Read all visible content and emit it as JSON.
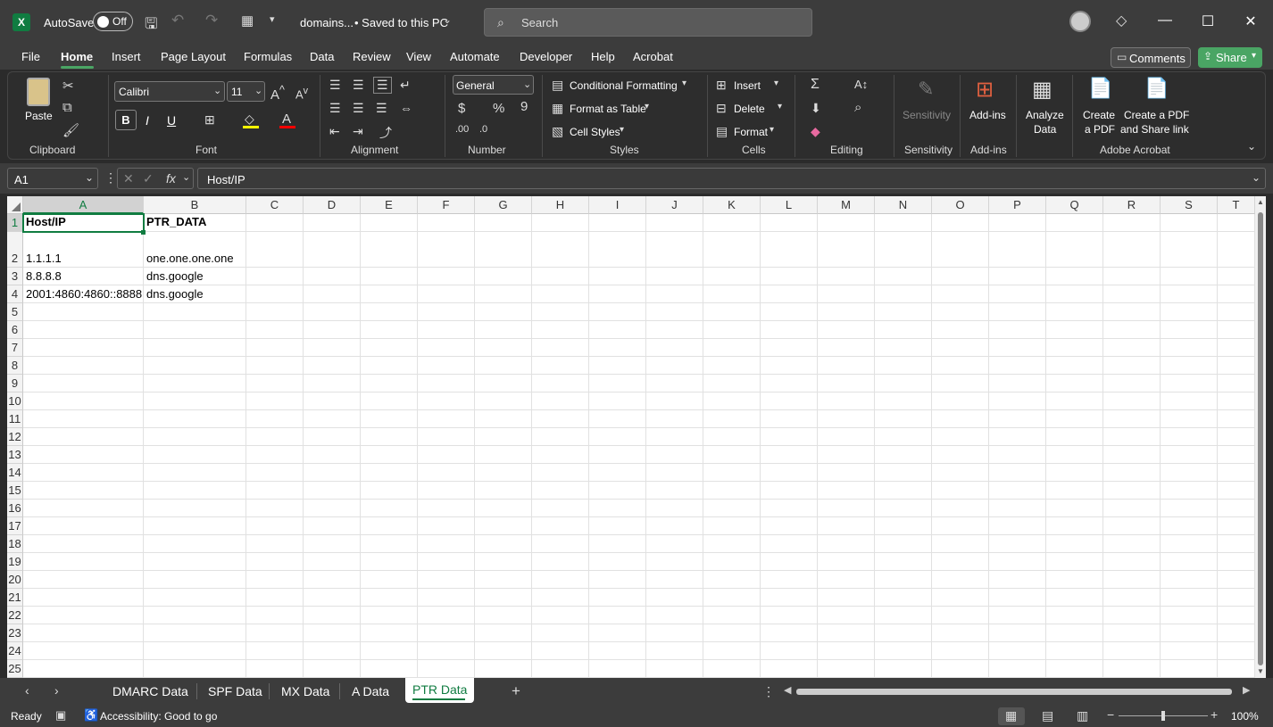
{
  "titlebar": {
    "autosave": "AutoSave",
    "autosave_state": "Off",
    "filename": "domains...",
    "save_status": "• Saved to this PC",
    "search_placeholder": "Search"
  },
  "menu": [
    "File",
    "Home",
    "Insert",
    "Page Layout",
    "Formulas",
    "Data",
    "Review",
    "View",
    "Automate",
    "Developer",
    "Help",
    "Acrobat"
  ],
  "menu_right": {
    "comments": "Comments",
    "share": "Share"
  },
  "ribbon": {
    "clipboard": {
      "paste": "Paste",
      "label": "Clipboard"
    },
    "font": {
      "name": "Calibri",
      "size": "11",
      "label": "Font",
      "bold": "B",
      "italic": "I",
      "underline": "U"
    },
    "alignment": {
      "label": "Alignment"
    },
    "number": {
      "format": "General",
      "label": "Number"
    },
    "styles": {
      "conditional": "Conditional Formatting",
      "table": "Format as Table",
      "cell_styles": "Cell Styles",
      "label": "Styles"
    },
    "cells": {
      "insert": "Insert",
      "delete": "Delete",
      "format": "Format",
      "label": "Cells"
    },
    "editing": {
      "label": "Editing"
    },
    "sensitivity": {
      "btn": "Sensitivity",
      "label": "Sensitivity"
    },
    "addins": {
      "btn": "Add-ins",
      "label": "Add-ins"
    },
    "analyze": {
      "line1": "Analyze",
      "line2": "Data"
    },
    "acrobat": {
      "create1": "Create",
      "create2": "a PDF",
      "share1": "Create a PDF",
      "share2": "and Share link",
      "label": "Adobe Acrobat"
    }
  },
  "formula_bar": {
    "name_box": "A1",
    "fx": "fx",
    "content": "Host/IP"
  },
  "columns": [
    "A",
    "B",
    "C",
    "D",
    "E",
    "F",
    "G",
    "H",
    "I",
    "J",
    "K",
    "L",
    "M",
    "N",
    "O",
    "P",
    "Q",
    "R",
    "S",
    "T"
  ],
  "rows": [
    "1",
    "2",
    "3",
    "4",
    "5",
    "6",
    "7",
    "8",
    "9",
    "10",
    "11",
    "12",
    "13",
    "14",
    "15",
    "16",
    "17",
    "18",
    "19",
    "20",
    "21",
    "22",
    "23",
    "24",
    "25"
  ],
  "cells": {
    "A1": "Host/IP",
    "B1": "PTR_DATA",
    "A2": "1.1.1.1",
    "B2": "one.one.one.one",
    "A3": "8.8.8.8",
    "B3": "dns.google",
    "A4": "2001:4860:4860::8888",
    "B4": "dns.google"
  },
  "sheets": [
    "DMARC Data",
    "SPF Data",
    "MX Data",
    "A Data",
    "PTR Data"
  ],
  "active_sheet": "PTR Data",
  "status": {
    "ready": "Ready",
    "accessibility": "Accessibility: Good to go",
    "zoom": "100%"
  },
  "colors": {
    "accent": "#107c41",
    "share": "#4aa564",
    "bg": "#3c3c3c"
  }
}
